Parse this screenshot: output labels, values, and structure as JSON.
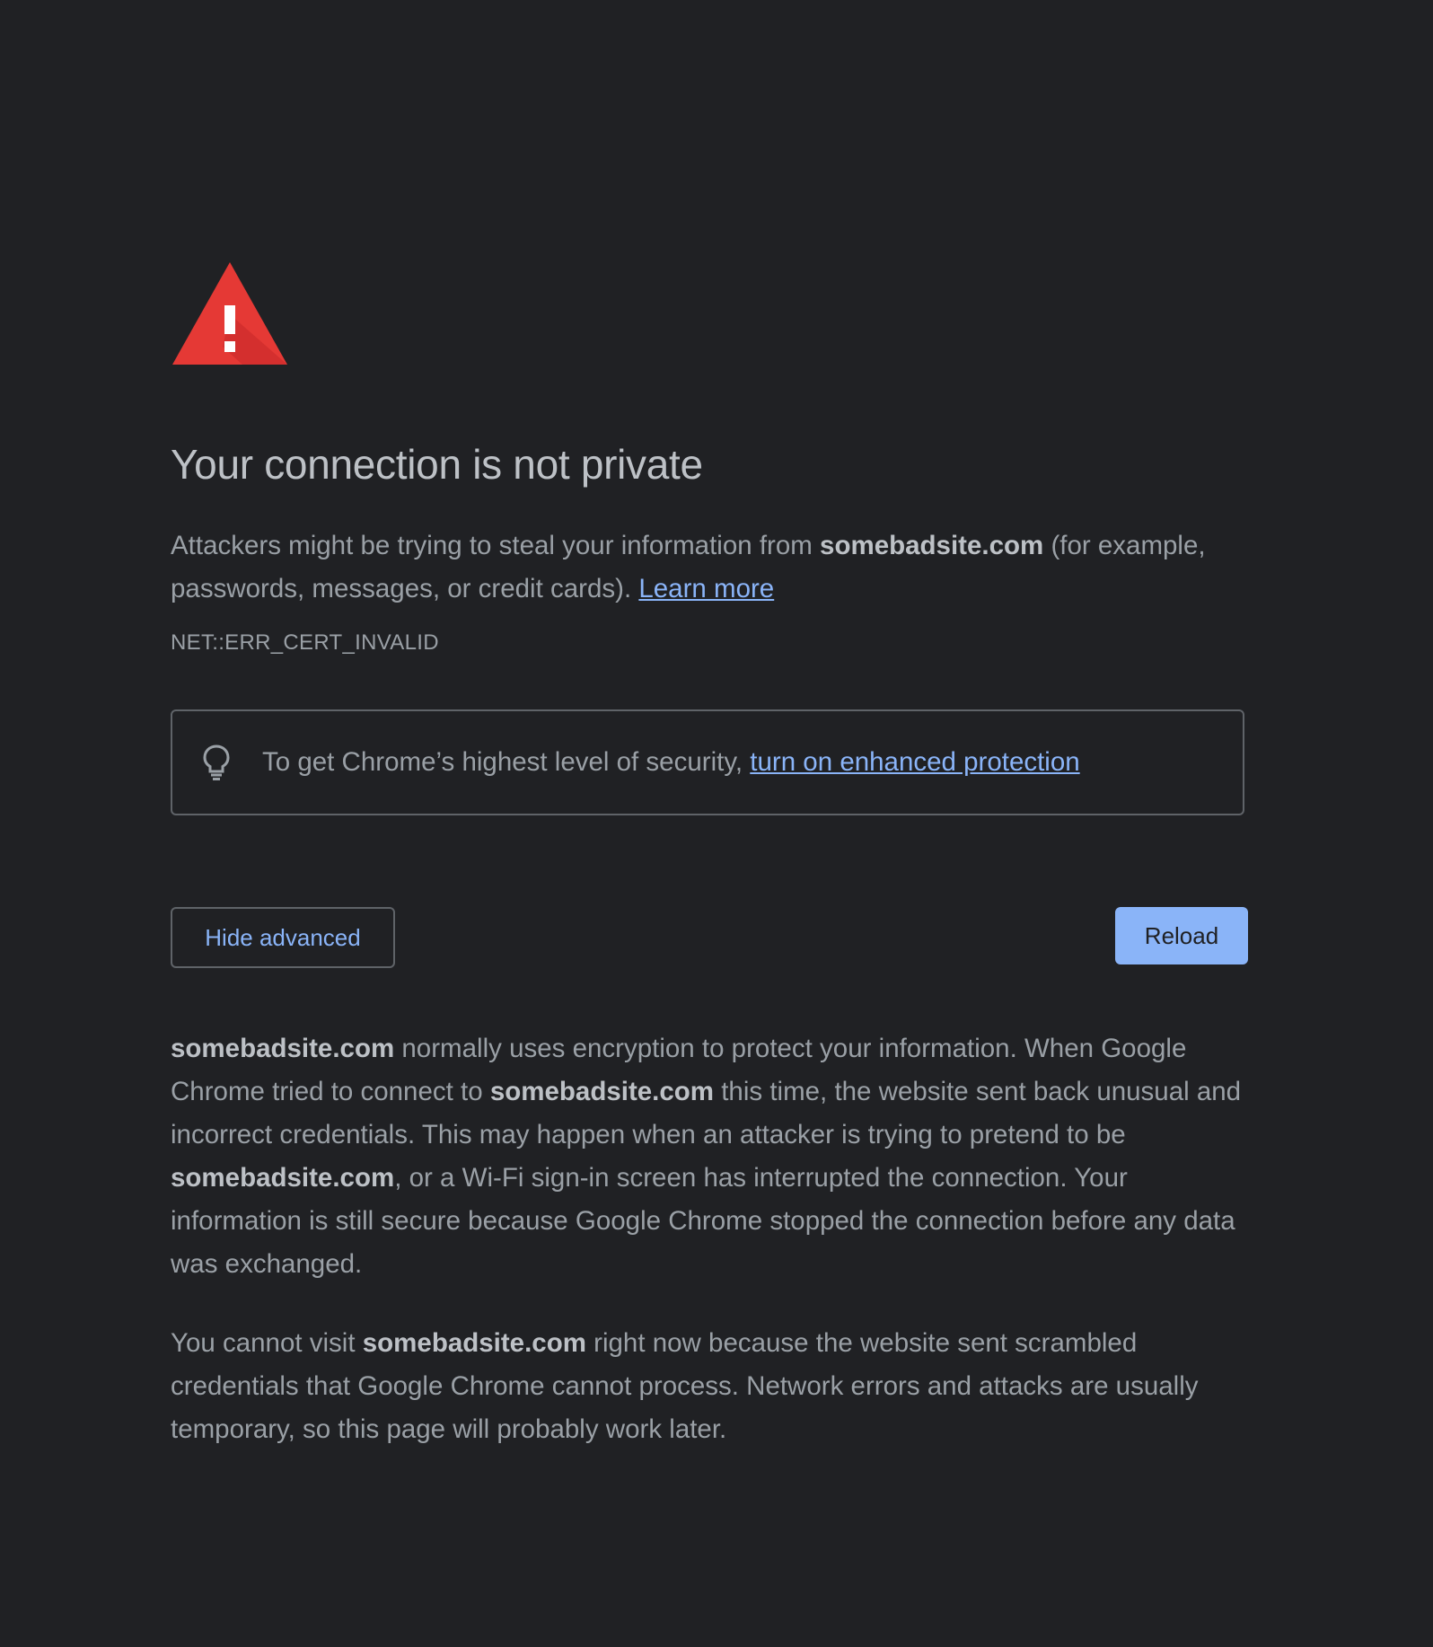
{
  "icons": {
    "warning": "warning-triangle-icon",
    "tip": "lightbulb-icon"
  },
  "colors": {
    "background": "#202124",
    "warning_red": "#e53935",
    "link": "#8ab4f8",
    "primary_button": "#8ab4f8",
    "text": "#9aa0a6",
    "title": "#bdc1c6"
  },
  "heading": "Your connection is not private",
  "lead": {
    "part1": "Attackers might be trying to steal your information from ",
    "domain": "somebadsite.com",
    "part2": " (for example, passwords, messages, or credit cards). ",
    "learn_more": "Learn more"
  },
  "error_code": "NET::ERR_CERT_INVALID",
  "tip": {
    "text": "To get Chrome’s highest level of security, ",
    "link": "turn on enhanced protection"
  },
  "buttons": {
    "hide_advanced": "Hide advanced",
    "reload": "Reload"
  },
  "details": {
    "p1": {
      "domain1": "somebadsite.com",
      "t1": " normally uses encryption to protect your information. When Google Chrome tried to connect to ",
      "domain2": "somebadsite.com",
      "t2": " this time, the website sent back unusual and incorrect credentials. This may happen when an attacker is trying to pretend to be ",
      "domain3": "somebadsite.com",
      "t3": ", or a Wi-Fi sign-in screen has interrupted the connection. Your information is still secure because Google Chrome stopped the connection before any data was exchanged."
    },
    "p2": {
      "t1": "You cannot visit ",
      "domain": "somebadsite.com",
      "t2": " right now because the website sent scrambled credentials that Google Chrome cannot process. Network errors and attacks are usually temporary, so this page will probably work later."
    }
  }
}
